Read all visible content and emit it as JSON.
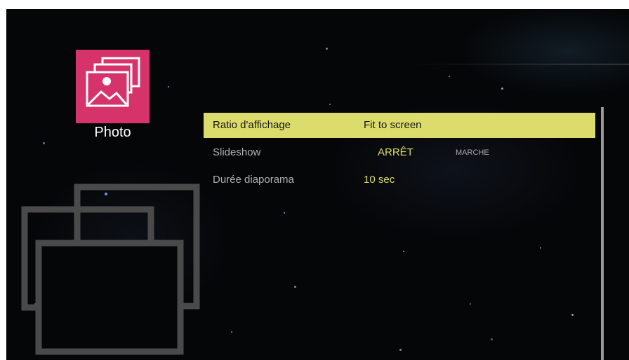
{
  "app": {
    "title": "Photo",
    "icon": "photo-gallery-icon",
    "accent": "#d6336a"
  },
  "menu": {
    "highlight_color": "#dcdc6c",
    "rows": [
      {
        "label": "Ratio d'affichage",
        "value": "Fit to screen"
      },
      {
        "label": "Slideshow",
        "value": "ARRÊT",
        "alt_value": "MARCHE"
      },
      {
        "label": "Durée diaporama",
        "value": "10 sec"
      }
    ]
  }
}
